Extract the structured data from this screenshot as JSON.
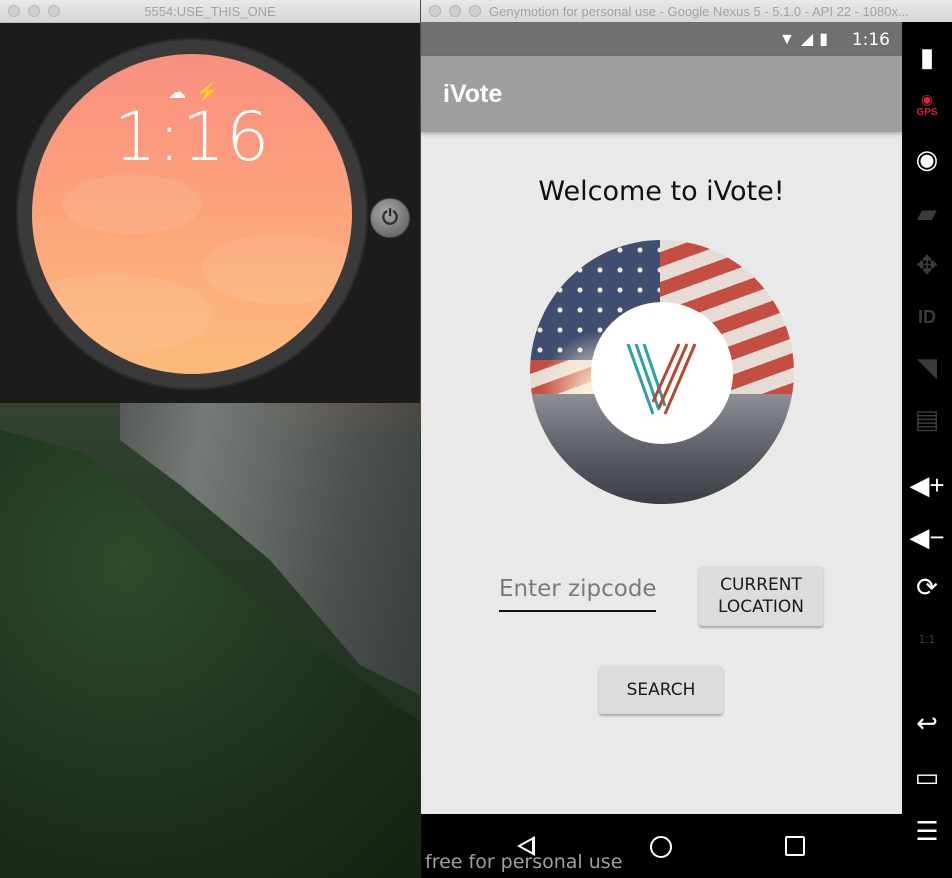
{
  "wear_window": {
    "title": "5554:USE_THIS_ONE",
    "watch": {
      "time": "1:16",
      "status_icons": [
        "cloud-off-icon",
        "charging-bolt-icon"
      ],
      "power_icon": "power-icon"
    }
  },
  "genymotion_window": {
    "title": "Genymotion for personal use - Google Nexus 5 - 5.1.0 - API 22 - 1080x...",
    "status_bar": {
      "time": "1:16",
      "icons": [
        "wifi-icon",
        "cellular-icon",
        "battery-icon"
      ]
    },
    "app_bar": {
      "title": "iVote"
    },
    "main": {
      "welcome_text": "Welcome to iVote!",
      "logo_letter": "V",
      "zipcode_input": {
        "placeholder": "Enter zipcode",
        "value": ""
      },
      "current_location_button": {
        "label_line1": "CURRENT",
        "label_line2": "LOCATION"
      },
      "search_button": {
        "label": "SEARCH"
      }
    },
    "nav_bar": {
      "items": [
        "back-icon",
        "home-icon",
        "recents-icon"
      ]
    },
    "watermark": "free for personal use",
    "toolbar": {
      "items": [
        "battery-widget",
        "gps-widget",
        "camera-widget",
        "capture-widget",
        "remote-control-widget",
        "identifiers-widget",
        "network-widget",
        "sms-widget",
        "volume-up",
        "volume-down",
        "rotate",
        "pixel-perfect",
        "back",
        "recent-apps",
        "menu"
      ],
      "gps_label": "GPS",
      "pixel_label": "1:1"
    }
  },
  "colors": {
    "app_bar": "#9e9e9e",
    "status_bar": "#707070",
    "watch_face_top": "#f98f80",
    "watch_face_bottom": "#fbbb79",
    "logo_teal": "#2e9ea8",
    "logo_rust": "#b5492e"
  }
}
